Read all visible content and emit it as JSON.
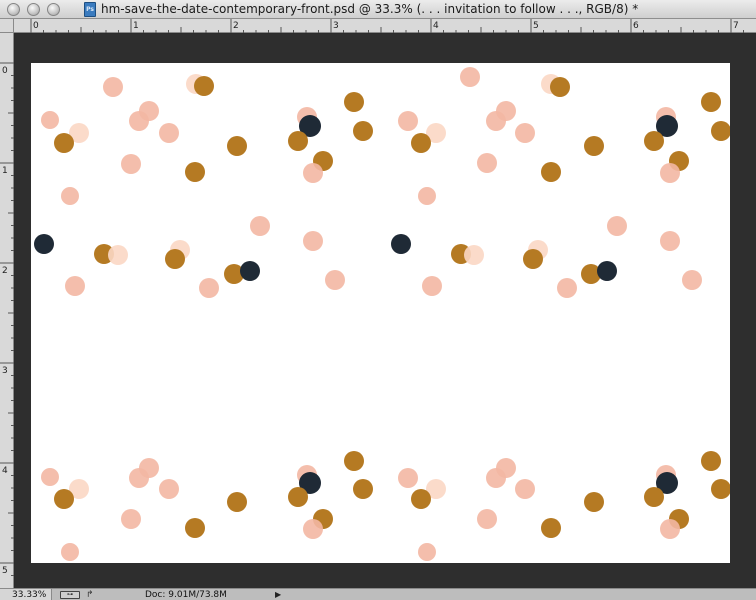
{
  "window": {
    "title": "hm-save-the-date-contemporary-front.psd @ 33.3% (. . . invitation to follow . . ., RGB/8) *",
    "doc_icon_label": "Ps"
  },
  "rulers": {
    "unit": "inches",
    "top_labels": [
      "0",
      "1",
      "2",
      "3",
      "4",
      "5",
      "6",
      "7"
    ],
    "left_labels": [
      "0",
      "1",
      "2",
      "3",
      "4",
      "5"
    ]
  },
  "status": {
    "zoom": "33.33%",
    "doc_info": "Doc: 9.01M/73.8M",
    "arrow": "▶"
  },
  "colors": {
    "pink": "#f3b7a3",
    "peach": "#fbd7c4",
    "gold": "#b57a23",
    "navy": "#1f2a36",
    "canvas": "#ffffff",
    "workspace": "#2e2e2e"
  }
}
